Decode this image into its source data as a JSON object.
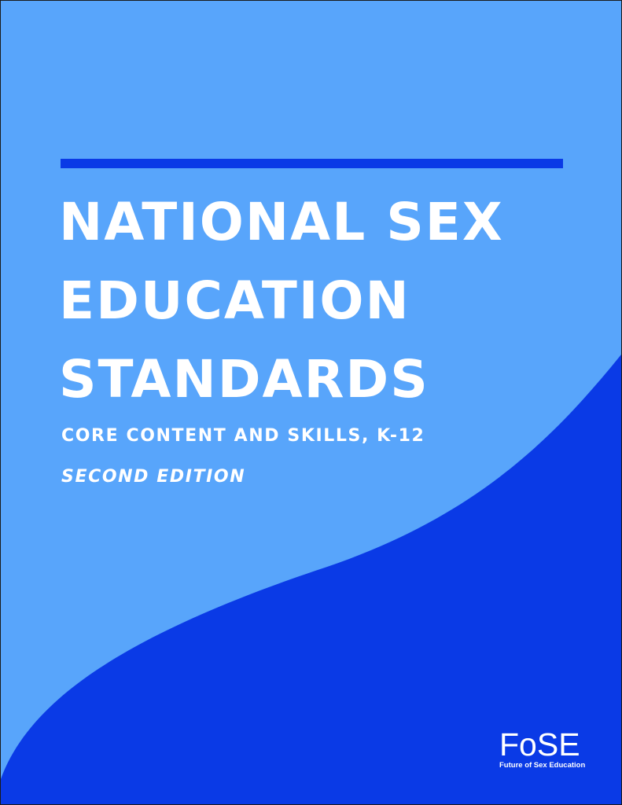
{
  "colors": {
    "background": "#58a5fb",
    "wave": "#0a3ae6",
    "rule": "#0a3ae6",
    "text": "#ffffff"
  },
  "cover": {
    "title_lines": [
      "NATIONAL SEX",
      "EDUCATION",
      "STANDARDS"
    ],
    "subtitle": "CORE CONTENT AND SKILLS, K-12",
    "edition": "SECOND EDITION"
  },
  "logo": {
    "mark": "FoSE",
    "tagline": "Future of Sex Education"
  }
}
